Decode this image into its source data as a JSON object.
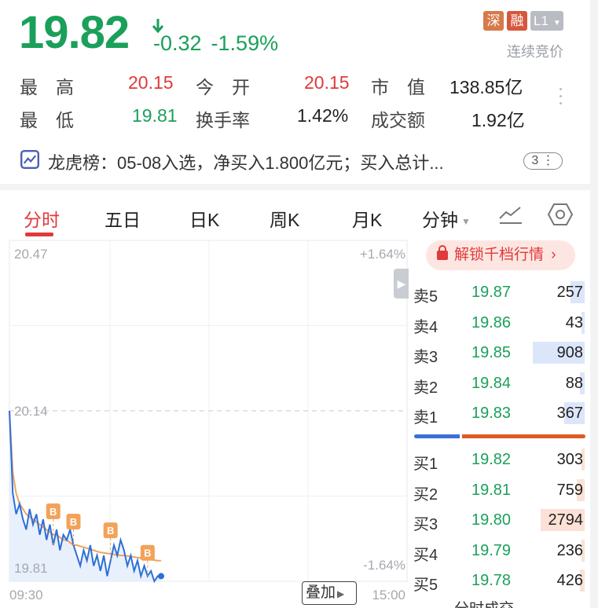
{
  "quote": {
    "price": "19.82",
    "change": "-0.32",
    "change_pct": "-1.59%",
    "badges": [
      "深",
      "融",
      "L1"
    ],
    "auction_status": "连续竞价",
    "colors": {
      "down": "#1aa05a",
      "up": "#e03a3a"
    }
  },
  "stats": {
    "high_label": "最　高",
    "high": "20.15",
    "open_label": "今　开",
    "open": "20.15",
    "mktcap_label": "市　值",
    "mktcap": "138.85亿",
    "low_label": "最　低",
    "low": "19.81",
    "turnover_label": "换手率",
    "turnover": "1.42%",
    "amount_label": "成交额",
    "amount": "1.92亿"
  },
  "dragon_tiger": {
    "icon": "chart-line-icon",
    "text": "龙虎榜：05-08入选，净买入1.800亿元；买入总计...",
    "count": "3"
  },
  "tabs": {
    "items": [
      "分时",
      "五日",
      "日K",
      "周K",
      "月K",
      "分钟"
    ],
    "active": "分时",
    "tool_icons": [
      "trend-line-icon",
      "settings-hexagon-icon"
    ]
  },
  "chart": {
    "y_top": "20.47",
    "y_mid": "20.14",
    "y_bottom": "19.81",
    "pct_top": "+1.64%",
    "pct_bottom": "-1.64%",
    "time_start": "09:30",
    "time_end": "15:00",
    "overlay_label": "叠加",
    "marker_label": "B",
    "chart_data": {
      "type": "line",
      "xlabel": "",
      "ylabel": "",
      "ylim": [
        19.81,
        20.47
      ],
      "prev_close": 20.14,
      "series": [
        {
          "color": "#2d6fd8",
          "values": [
            20.14,
            19.98,
            19.94,
            19.96,
            19.93,
            19.91,
            19.95,
            19.92,
            19.94,
            19.9,
            19.93,
            19.89,
            19.92,
            19.88,
            19.91,
            19.87,
            19.9,
            19.89,
            19.91,
            19.88,
            19.86,
            19.84,
            19.87,
            19.85,
            19.88,
            19.84,
            19.86,
            19.83,
            19.86,
            19.82,
            19.85,
            19.88,
            19.86,
            19.89,
            19.87,
            19.84,
            19.86,
            19.83,
            19.85,
            19.82,
            19.84,
            19.82,
            19.83,
            19.81,
            19.82,
            19.82
          ]
        },
        {
          "color": "#f0a35e",
          "values": [
            20.14,
            20.02,
            19.98,
            19.96,
            19.95,
            19.94,
            19.935,
            19.93,
            19.925,
            19.92,
            19.915,
            19.91,
            19.905,
            19.9,
            19.9,
            19.895,
            19.89,
            19.89,
            19.885,
            19.88,
            19.88,
            19.878,
            19.876,
            19.874,
            19.872,
            19.87,
            19.868,
            19.866,
            19.865,
            19.864,
            19.863,
            19.862,
            19.861,
            19.86,
            19.86,
            19.859,
            19.858,
            19.857,
            19.856,
            19.855,
            19.854,
            19.853,
            19.852,
            19.851,
            19.85,
            19.85
          ]
        }
      ],
      "markers": [
        {
          "label": "B",
          "index": 13
        },
        {
          "label": "B",
          "index": 19
        },
        {
          "label": "B",
          "index": 30
        },
        {
          "label": "B",
          "index": 41
        }
      ]
    }
  },
  "order_book": {
    "unlock_label": "解锁千档行情",
    "asks": [
      {
        "name": "卖5",
        "price": "19.87",
        "vol": "257",
        "ratio": 0.09
      },
      {
        "name": "卖4",
        "price": "19.86",
        "vol": "43",
        "ratio": 0.02
      },
      {
        "name": "卖3",
        "price": "19.85",
        "vol": "908",
        "ratio": 0.33
      },
      {
        "name": "卖2",
        "price": "19.84",
        "vol": "88",
        "ratio": 0.03
      },
      {
        "name": "卖1",
        "price": "19.83",
        "vol": "367",
        "ratio": 0.13
      }
    ],
    "bids": [
      {
        "name": "买1",
        "price": "19.82",
        "vol": "303",
        "ratio": 0.02
      },
      {
        "name": "买2",
        "price": "19.81",
        "vol": "759",
        "ratio": 0.05
      },
      {
        "name": "买3",
        "price": "19.80",
        "vol": "2794",
        "ratio": 0.28
      },
      {
        "name": "买4",
        "price": "19.79",
        "vol": "236",
        "ratio": 0.02
      },
      {
        "name": "买5",
        "price": "19.78",
        "vol": "426",
        "ratio": 0.03
      }
    ],
    "bottom_label": "分时成交"
  }
}
